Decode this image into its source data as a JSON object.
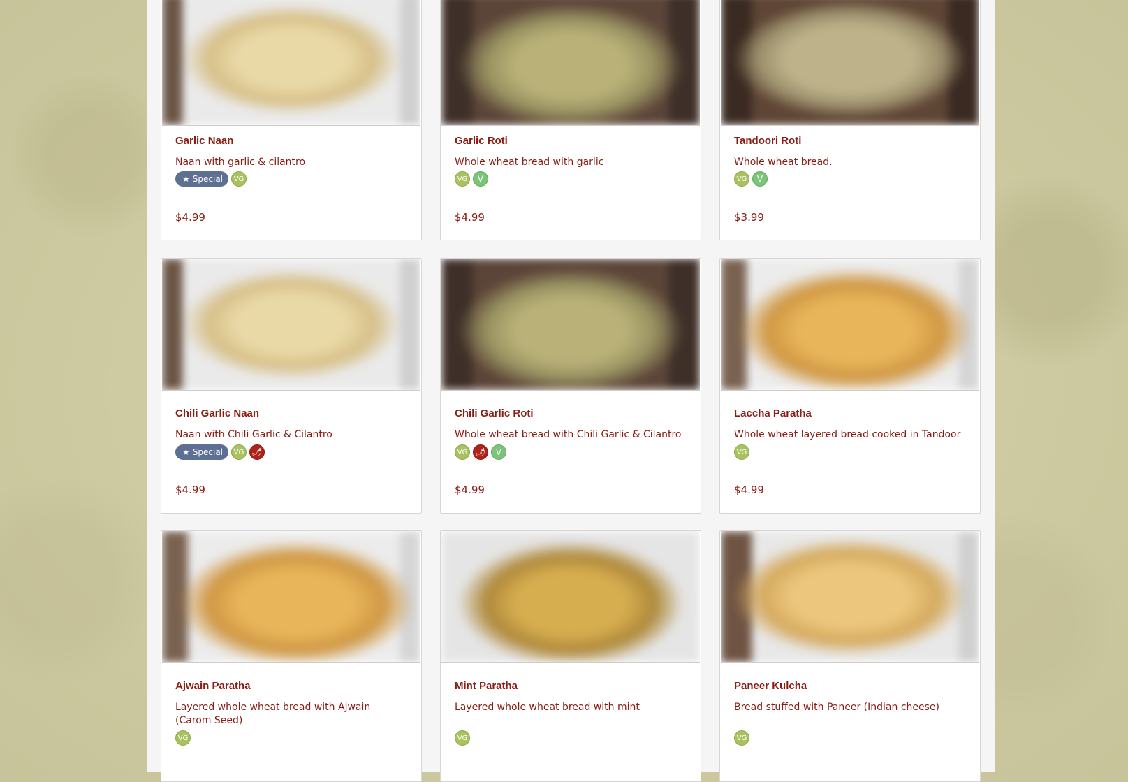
{
  "labels": {
    "special": "Special",
    "vg": "VG",
    "v": "V"
  },
  "items": [
    {
      "name": "Garlic Naan",
      "desc": "Naan with garlic & cilantro",
      "price": "$4.99",
      "special": true,
      "tags": [
        "vg"
      ],
      "photo": "naan"
    },
    {
      "name": "Garlic Roti",
      "desc": "Whole wheat bread with garlic",
      "price": "$4.99",
      "special": false,
      "tags": [
        "vg",
        "v"
      ],
      "photo": "roti"
    },
    {
      "name": "Tandoori Roti",
      "desc": "Whole wheat bread.",
      "price": "$3.99",
      "special": false,
      "tags": [
        "vg",
        "v"
      ],
      "photo": "tandoori"
    },
    {
      "name": "Chili Garlic Naan",
      "desc": "Naan with Chili Garlic & Cilantro",
      "price": "$4.99",
      "special": true,
      "tags": [
        "vg",
        "spicy"
      ],
      "photo": "naan"
    },
    {
      "name": "Chili Garlic Roti",
      "desc": "Whole wheat bread with Chili Garlic & Cilantro",
      "price": "$4.99",
      "special": false,
      "tags": [
        "vg",
        "spicy",
        "v"
      ],
      "photo": "roti"
    },
    {
      "name": "Laccha Paratha",
      "desc": "Whole wheat layered bread cooked in Tandoor",
      "price": "$4.99",
      "special": false,
      "tags": [
        "vg"
      ],
      "photo": "paratha"
    },
    {
      "name": "Ajwain Paratha",
      "desc": "Layered whole wheat bread with Ajwain (Carom Seed)",
      "special": false,
      "tags": [
        "vg"
      ],
      "photo": "paratha"
    },
    {
      "name": "Mint Paratha",
      "desc": "Layered whole wheat bread with mint",
      "special": false,
      "tags": [
        "vg"
      ],
      "photo": "mint"
    },
    {
      "name": "Paneer Kulcha",
      "desc": "Bread stuffed with Paneer (Indian cheese)",
      "special": false,
      "tags": [
        "vg"
      ],
      "photo": "kulcha"
    }
  ]
}
